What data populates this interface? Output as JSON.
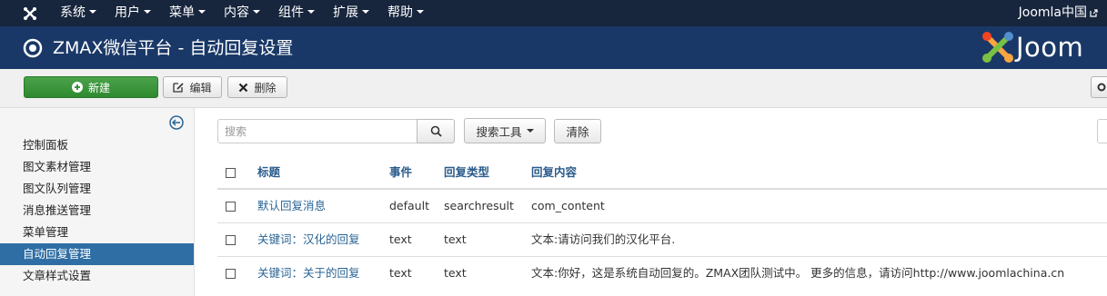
{
  "navbar": {
    "menu": [
      {
        "label": "系统"
      },
      {
        "label": "用户"
      },
      {
        "label": "菜单"
      },
      {
        "label": "内容"
      },
      {
        "label": "组件"
      },
      {
        "label": "扩展"
      },
      {
        "label": "帮助"
      }
    ],
    "site_link": "Joomla中国"
  },
  "header": {
    "title": "ZMAX微信平台 - 自动回复设置",
    "brand": "Joom"
  },
  "toolbar": {
    "new_label": "新建",
    "edit_label": "编辑",
    "delete_label": "删除"
  },
  "sidebar": {
    "items": [
      {
        "label": "控制面板"
      },
      {
        "label": "图文素材管理"
      },
      {
        "label": "图文队列管理"
      },
      {
        "label": "消息推送管理"
      },
      {
        "label": "菜单管理"
      },
      {
        "label": "自动回复管理"
      },
      {
        "label": "文章样式设置"
      }
    ],
    "active_index": 5
  },
  "filters": {
    "search_placeholder": "搜索",
    "search_value": "",
    "tools_label": "搜索工具",
    "clear_label": "清除"
  },
  "table": {
    "headers": {
      "title": "标题",
      "event": "事件",
      "type": "回复类型",
      "content": "回复内容"
    },
    "rows": [
      {
        "title": "默认回复消息",
        "event": "default",
        "type": "searchresult",
        "content": "com_content"
      },
      {
        "title": "关键词：汉化的回复",
        "event": "text",
        "type": "text",
        "content": "文本:请访问我们的汉化平台."
      },
      {
        "title": "关键词：关于的回复",
        "event": "text",
        "type": "text",
        "content": "文本:你好，这是系统自动回复的。ZMAX团队测试中。 更多的信息，请访问http://www.joomlachina.cn"
      }
    ]
  },
  "colors": {
    "navbar_bg": "#17253d",
    "header_bg": "#1a3867",
    "new_button": "#3d9a3d",
    "sidebar_active": "#2f6ea5",
    "link": "#2a6496"
  }
}
